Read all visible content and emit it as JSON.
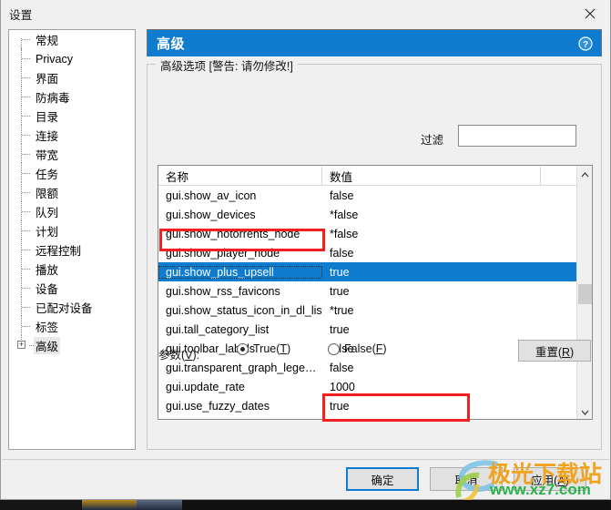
{
  "window": {
    "title": "设置",
    "close_icon": "close-icon"
  },
  "sidebar": {
    "items": [
      {
        "label": "常规",
        "expandable": false,
        "selected": false
      },
      {
        "label": "Privacy",
        "expandable": false,
        "selected": false
      },
      {
        "label": "界面",
        "expandable": false,
        "selected": false
      },
      {
        "label": "防病毒",
        "expandable": false,
        "selected": false
      },
      {
        "label": "目录",
        "expandable": false,
        "selected": false
      },
      {
        "label": "连接",
        "expandable": false,
        "selected": false
      },
      {
        "label": "带宽",
        "expandable": false,
        "selected": false
      },
      {
        "label": "任务",
        "expandable": false,
        "selected": false
      },
      {
        "label": "限额",
        "expandable": false,
        "selected": false
      },
      {
        "label": "队列",
        "expandable": false,
        "selected": false
      },
      {
        "label": "计划",
        "expandable": false,
        "selected": false
      },
      {
        "label": "远程控制",
        "expandable": false,
        "selected": false
      },
      {
        "label": "播放",
        "expandable": false,
        "selected": false
      },
      {
        "label": "设备",
        "expandable": false,
        "selected": false
      },
      {
        "label": "已配对设备",
        "expandable": false,
        "selected": false
      },
      {
        "label": "标签",
        "expandable": false,
        "selected": false
      },
      {
        "label": "高级",
        "expandable": true,
        "selected": true,
        "expander": "+"
      }
    ]
  },
  "panel": {
    "header_title": "高级",
    "help_icon": "help-icon",
    "group_legend": "高级选项 [警告: 请勿修改!]",
    "filter": {
      "label": "过滤",
      "value": "",
      "placeholder": ""
    },
    "list": {
      "columns": [
        "名称",
        "数值"
      ],
      "rows": [
        {
          "name": "gui.show_av_icon",
          "value": "false",
          "selected": false
        },
        {
          "name": "gui.show_devices",
          "value": "*false",
          "selected": false
        },
        {
          "name": "gui.show_notorrents_node",
          "value": "*false",
          "selected": false
        },
        {
          "name": "gui.show_player_node",
          "value": "false",
          "selected": false
        },
        {
          "name": "gui.show_plus_upsell",
          "value": "true",
          "selected": true
        },
        {
          "name": "gui.show_rss_favicons",
          "value": "true",
          "selected": false
        },
        {
          "name": "gui.show_status_icon_in_dl_list",
          "value": "*true",
          "selected": false
        },
        {
          "name": "gui.tall_category_list",
          "value": "true",
          "selected": false
        },
        {
          "name": "gui.toolbar_labels",
          "value": "false",
          "selected": false
        },
        {
          "name": "gui.transparent_graph_lege…",
          "value": "false",
          "selected": false
        },
        {
          "name": "gui.update_rate",
          "value": "1000",
          "selected": false
        },
        {
          "name": "gui.use_fuzzy_dates",
          "value": "true",
          "selected": false
        }
      ],
      "scrollbar": {
        "up_icon": "chevron-up-icon",
        "down_icon": "chevron-down-icon"
      }
    },
    "params": {
      "label": "参数(V):",
      "label_text": "参数(",
      "label_mnemonic": "V",
      "label_suffix": "):",
      "radio_true": {
        "text": "True(",
        "mnemonic": "T",
        "suffix": ")",
        "checked": true
      },
      "radio_false": {
        "text": "False(",
        "mnemonic": "F",
        "suffix": ")",
        "checked": false
      },
      "reset_button": {
        "text": "重置(",
        "mnemonic": "R",
        "suffix": ")"
      }
    }
  },
  "footer": {
    "ok": "确定",
    "cancel": "取消",
    "apply_text": "应用(",
    "apply_mnemonic": "A",
    "apply_suffix": ")"
  },
  "watermark": {
    "brand": "极光下载站",
    "url": "www.xz7.com"
  },
  "colors": {
    "accent_blue": "#0f7cd0",
    "annotation_red": "#f41f1f",
    "window_bg": "#f0f0f0",
    "watermark_orange": "#f0a31e",
    "watermark_green": "#2bb24c"
  }
}
